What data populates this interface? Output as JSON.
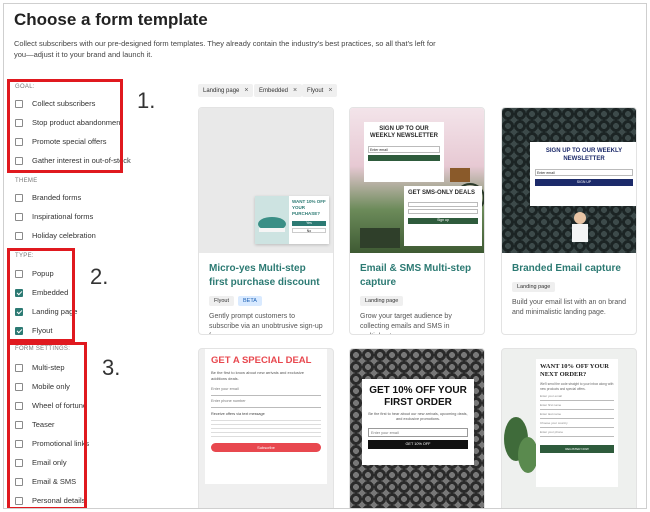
{
  "header": {
    "title": "Choose a form template",
    "description": "Collect subscribers with our pre-designed form templates. They already contain the industry's best practices, so all that's left for you—adjust it to your brand and launch it."
  },
  "filters": {
    "goal": {
      "heading": "GOAL",
      "items": [
        {
          "label": "Collect subscribers",
          "checked": false
        },
        {
          "label": "Stop product abandonment",
          "checked": false
        },
        {
          "label": "Promote special offers",
          "checked": false
        },
        {
          "label": "Gather interest in out-of-stock",
          "checked": false
        }
      ]
    },
    "theme": {
      "heading": "THEME",
      "items": [
        {
          "label": "Branded forms",
          "checked": false
        },
        {
          "label": "Inspirational forms",
          "checked": false
        },
        {
          "label": "Holiday celebration",
          "checked": false
        }
      ]
    },
    "type": {
      "heading": "TYPE",
      "items": [
        {
          "label": "Popup",
          "checked": false
        },
        {
          "label": "Embedded",
          "checked": true
        },
        {
          "label": "Landing page",
          "checked": true
        },
        {
          "label": "Flyout",
          "checked": true
        }
      ]
    },
    "settings": {
      "heading": "FORM SETTINGS",
      "items": [
        {
          "label": "Multi-step",
          "checked": false
        },
        {
          "label": "Mobile only",
          "checked": false
        },
        {
          "label": "Wheel of fortune",
          "checked": false
        },
        {
          "label": "Teaser",
          "checked": false
        },
        {
          "label": "Promotional links",
          "checked": false
        },
        {
          "label": "Email only",
          "checked": false
        },
        {
          "label": "Email & SMS",
          "checked": false
        },
        {
          "label": "Personal details",
          "checked": false
        }
      ]
    }
  },
  "annotations": {
    "one": "1.",
    "two": "2.",
    "three": "3."
  },
  "chips": [
    {
      "label": "Landing page",
      "close": "×"
    },
    {
      "label": "Embedded",
      "close": "×"
    },
    {
      "label": "Flyout",
      "close": "×"
    }
  ],
  "cards": [
    {
      "title": "Micro-yes Multi-step first purchase discount",
      "tags": [
        "Flyout",
        "BETA"
      ],
      "description": "Gently prompt customers to subscribe via an unobtrusive sign-up form",
      "preview": {
        "heading": "WANT 10% OFF YOUR PURCHASE?",
        "yes": "Yes",
        "no": "No"
      }
    },
    {
      "title": "Email & SMS Multi-step capture",
      "tags": [
        "Landing page"
      ],
      "description": "Grow your target audience by collecting emails and SMS in multiple steps.",
      "preview": {
        "heading": "SIGN UP TO OUR WEEKLY NEWSLETTER",
        "field": "Enter email",
        "sub": "GET SMS-ONLY DEALS",
        "btn": "Sign up"
      }
    },
    {
      "title": "Branded Email capture",
      "tags": [
        "Landing page"
      ],
      "description": "Build your email list with an on brand and minimalistic landing page.",
      "preview": {
        "heading": "SIGN UP TO OUR WEEKLY NEWSLETTER",
        "field": "Enter email",
        "btn": "SIGN UP"
      }
    },
    {
      "preview": {
        "heading": "GET A SPECIAL DEAL",
        "sub": "Be the first to know about new arrivals and exclusive additions deals.",
        "field1": "Enter your email",
        "field2": "Enter phone number",
        "consent": "Receive offers via text message",
        "btn": "Subscribe"
      }
    },
    {
      "preview": {
        "heading": "GET 10% OFF YOUR FIRST ORDER",
        "sub": "Be the first to hear about our new arrivals, upcoming deals, and exclusive promotions.",
        "field": "Enter your email",
        "btn": "GET 10% OFF"
      }
    },
    {
      "preview": {
        "heading": "WANT 10% OFF YOUR NEXT ORDER?",
        "sub": "We'll send the code straight to your inbox along with new products and special offers.",
        "fields": [
          "Enter your email",
          "Enter first name",
          "Enter last name",
          "Choose your country",
          "Enter your phone"
        ],
        "btn": "REGISTER NOW"
      }
    }
  ],
  "colors": {
    "accent": "#2c7a73",
    "annotation": "#e0191f",
    "deal_red": "#e8484f",
    "dark_green": "#2e5b3c"
  }
}
